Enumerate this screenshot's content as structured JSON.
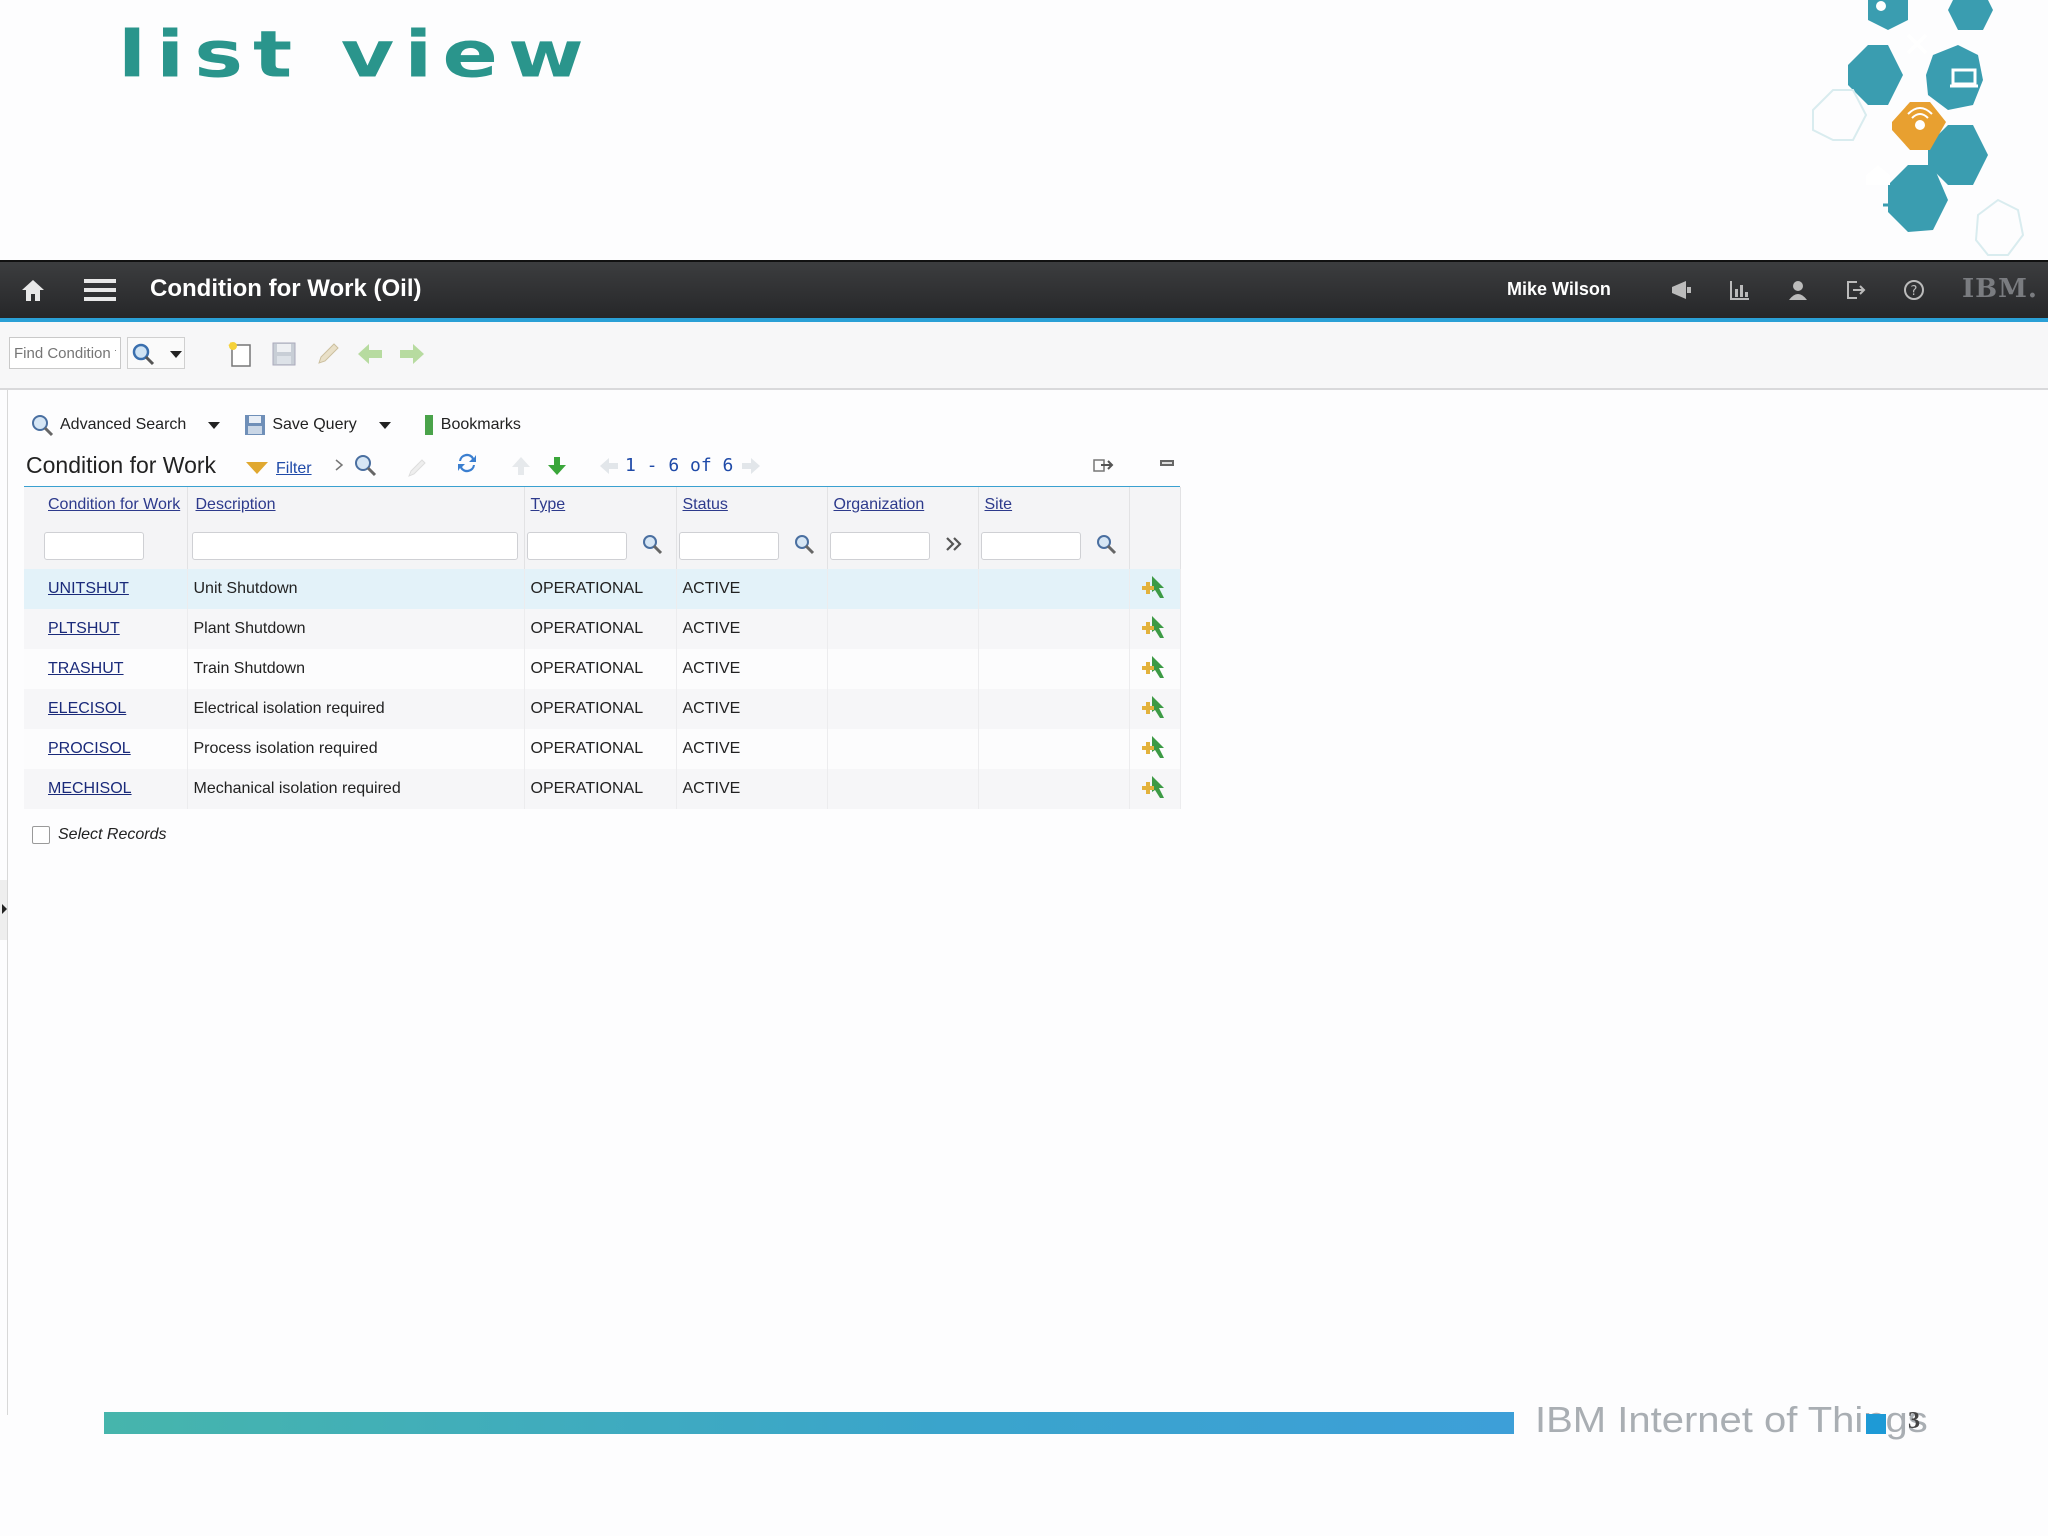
{
  "slide": {
    "title": "LIST VIEW",
    "footer_text": "IBM Internet of Things",
    "page_number": "3",
    "colors": {
      "title": "#2a958c",
      "accent_blue": "#2aa0d6",
      "hex_teal": "#3a9db0",
      "hex_orange": "#e8a030"
    }
  },
  "app": {
    "title": "Condition for Work (Oil)",
    "user": "Mike Wilson",
    "ibm_logo": "IBM.",
    "header_icons": [
      "home-icon",
      "menu-icon",
      "announce-icon",
      "report-icon",
      "profile-icon",
      "signout-icon",
      "help-icon"
    ]
  },
  "toolbar": {
    "find_placeholder": "Find Condition f",
    "icons": [
      "search-icon",
      "new-record-icon",
      "save-icon",
      "edit-icon",
      "back-icon",
      "forward-icon"
    ]
  },
  "actions": {
    "advanced_search": "Advanced Search",
    "save_query": "Save Query",
    "bookmarks": "Bookmarks"
  },
  "table": {
    "title": "Condition for Work",
    "filter_label": "Filter",
    "pager": "1 - 6 of 6",
    "columns": [
      "Condition for Work",
      "Description",
      "Type",
      "Status",
      "Organization",
      "Site"
    ],
    "rows": [
      {
        "code": "UNITSHUT",
        "description": "Unit Shutdown",
        "type": "OPERATIONAL",
        "status": "ACTIVE",
        "organization": "",
        "site": ""
      },
      {
        "code": "PLTSHUT",
        "description": "Plant Shutdown",
        "type": "OPERATIONAL",
        "status": "ACTIVE",
        "organization": "",
        "site": ""
      },
      {
        "code": "TRASHUT",
        "description": "Train Shutdown",
        "type": "OPERATIONAL",
        "status": "ACTIVE",
        "organization": "",
        "site": ""
      },
      {
        "code": "ELECISOL",
        "description": "Electrical isolation required",
        "type": "OPERATIONAL",
        "status": "ACTIVE",
        "organization": "",
        "site": ""
      },
      {
        "code": "PROCISOL",
        "description": "Process isolation required",
        "type": "OPERATIONAL",
        "status": "ACTIVE",
        "organization": "",
        "site": ""
      },
      {
        "code": "MECHISOL",
        "description": "Mechanical isolation required",
        "type": "OPERATIONAL",
        "status": "ACTIVE",
        "organization": "",
        "site": ""
      }
    ],
    "select_records": "Select Records"
  }
}
